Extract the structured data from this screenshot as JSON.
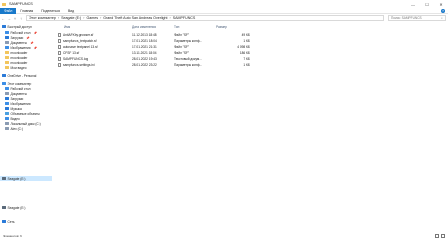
{
  "window": {
    "title": "SAMPFUNCS",
    "minimize": "—",
    "maximize": "☐",
    "close": "✕"
  },
  "ribbon": {
    "tabs": [
      "Файл",
      "Главная",
      "Поделиться",
      "Вид"
    ],
    "help": "?"
  },
  "nav": {
    "back": "←",
    "forward": "→",
    "recent": "˅",
    "up": "↑",
    "breadcrumbs": [
      "Этот компьютер",
      "Seagate (E:)",
      "Games",
      "Grand Theft Auto San Andreas Overlight",
      "SAMPFUNCS"
    ],
    "search_placeholder": "Поиск: SAMPFUNCS",
    "search_icon": "⌕"
  },
  "sidebar": {
    "items": [
      {
        "label": "Быстрый доступ",
        "icon": "star-icon",
        "color": "#2a7ad8",
        "pinned": false
      },
      {
        "label": "Рабочий стол",
        "icon": "desktop-icon",
        "color": "#3c8ee6",
        "pinned": true
      },
      {
        "label": "Загрузки",
        "icon": "downloads-icon",
        "color": "#2a7ad8",
        "pinned": true
      },
      {
        "label": "Документы",
        "icon": "documents-icon",
        "color": "#8a9bb3",
        "pinned": true
      },
      {
        "label": "Изображения",
        "icon": "pictures-icon",
        "color": "#3c8ee6",
        "pinned": true
      },
      {
        "label": "moonloader",
        "icon": "folder-icon",
        "color": "#f2c55c",
        "pinned": false
      },
      {
        "label": "moonloader",
        "icon": "folder-icon",
        "color": "#f2c55c",
        "pinned": false
      },
      {
        "label": "moonloader",
        "icon": "folder-icon",
        "color": "#f2c55c",
        "pinned": false
      },
      {
        "label": "Мои видео",
        "icon": "folder-icon",
        "color": "#f2c55c",
        "pinned": false
      },
      {
        "label": "OneDrive - Personal",
        "icon": "cloud-icon",
        "color": "#2a7ad8",
        "pinned": false
      },
      {
        "label": "Этот компьютер",
        "icon": "computer-icon",
        "color": "#3c8ee6",
        "pinned": false
      },
      {
        "label": "Рабочий стол",
        "icon": "desktop-icon",
        "color": "#3c8ee6",
        "pinned": false
      },
      {
        "label": "Документы",
        "icon": "documents-icon",
        "color": "#8a9bb3",
        "pinned": false
      },
      {
        "label": "Загрузки",
        "icon": "downloads-icon",
        "color": "#2a7ad8",
        "pinned": false
      },
      {
        "label": "Изображения",
        "icon": "pictures-icon",
        "color": "#3c8ee6",
        "pinned": false
      },
      {
        "label": "Музыка",
        "icon": "music-icon",
        "color": "#2a7ad8",
        "pinned": false
      },
      {
        "label": "Объемные объекты",
        "icon": "3d-objects-icon",
        "color": "#4aa0e0",
        "pinned": false
      },
      {
        "label": "Видео",
        "icon": "videos-icon",
        "color": "#3c8ee6",
        "pinned": false
      },
      {
        "label": "Локальный диск (C:)",
        "icon": "drive-icon",
        "color": "#8a9bb3",
        "pinned": false
      },
      {
        "label": "Alex (C:)",
        "icon": "drive-icon",
        "color": "#8a9bb3",
        "pinned": false
      },
      {
        "label": "Seagate (E:)",
        "icon": "drive-icon",
        "color": "#5a6a7a",
        "pinned": false,
        "selected": true
      },
      {
        "label": "Seagate (E:)",
        "icon": "drive-icon",
        "color": "#5a6a7a",
        "pinned": false
      },
      {
        "label": "Сеть",
        "icon": "network-icon",
        "color": "#2a7ad8",
        "pinned": false
      }
    ]
  },
  "files": {
    "headers": [
      "Имя",
      "Дата изменения",
      "Тип",
      "Размер"
    ],
    "rows": [
      {
        "name": "AntiAFKby.growser.sf",
        "date": "11.12.2013 18:48",
        "type": "Файл \"SF\"",
        "size": "49 КБ"
      },
      {
        "name": "sampfuncs_textpatch.sf",
        "date": "17.01.2021 18:04",
        "type": "Параметры конф...",
        "size": "1 КБ"
      },
      {
        "name": "autosave textpanel 13.sf",
        "date": "17.01.2021 21:31",
        "type": "Файл \"SF\"",
        "size": "4 098 КБ"
      },
      {
        "name": "CFSF 13.sf",
        "date": "13.11.2021 18:04",
        "type": "Файл \"SF\"",
        "size": "186 КБ"
      },
      {
        "name": "SAMPFUNCS.log",
        "date": "28.01.2022 19:43",
        "type": "Текстовый докум...",
        "size": "7 КБ"
      },
      {
        "name": "sampfuncs-settings.ini",
        "date": "28.01.2022 23:22",
        "type": "Параметры конф...",
        "size": "1 КБ"
      }
    ]
  },
  "status": {
    "count": "Элементов: 6"
  }
}
